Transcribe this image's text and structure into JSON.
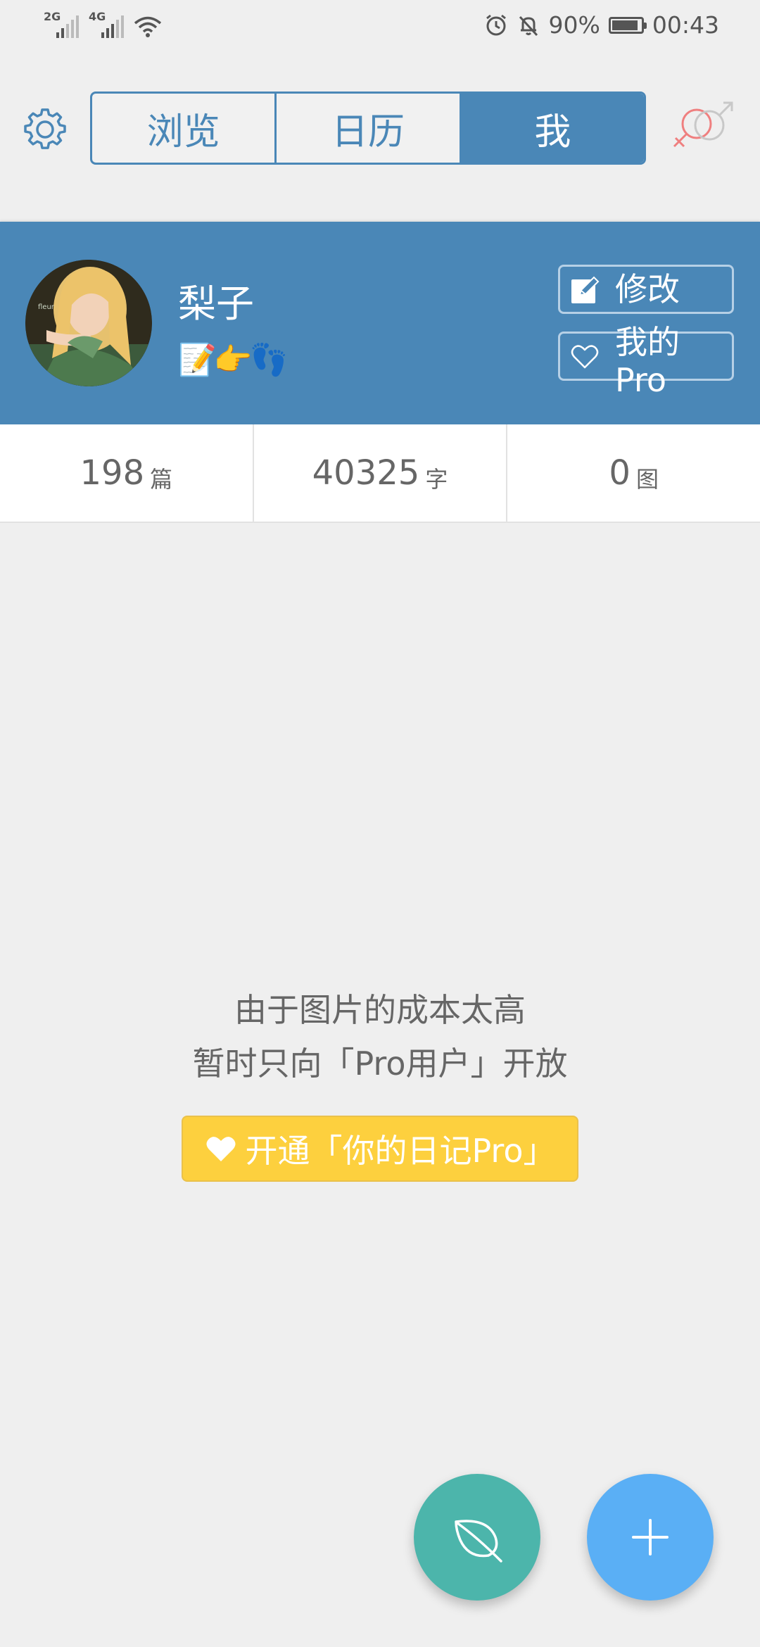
{
  "status_bar": {
    "sim1": "2G",
    "sim2": "4G",
    "battery_percent": "90%",
    "battery_level": 0.9,
    "time": "00:43",
    "icons": [
      "signal-icon",
      "wifi-icon",
      "alarm-icon",
      "mute-bell-icon",
      "battery-icon"
    ]
  },
  "nav": {
    "tabs": [
      {
        "label": "浏览",
        "active": false
      },
      {
        "label": "日历",
        "active": false
      },
      {
        "label": "我",
        "active": true
      }
    ],
    "icons": {
      "left": "gear-icon",
      "right": "gender-icon"
    }
  },
  "profile": {
    "name": "梨子",
    "bio": "📝👉👣",
    "edit_label": "修改",
    "pro_label": "我的Pro",
    "colors": {
      "header": "#4a87b7"
    }
  },
  "stats": [
    {
      "value": "198",
      "unit": "篇"
    },
    {
      "value": "40325",
      "unit": "字"
    },
    {
      "value": "0",
      "unit": "图"
    }
  ],
  "notice": {
    "line1": "由于图片的成本太高",
    "line2": "暂时只向「Pro用户」开放",
    "cta": "开通「你的日记Pro」",
    "cta_color": "#fdd03e"
  },
  "fabs": {
    "leaf_color": "#4cb5ab",
    "add_color": "#5aaff5",
    "icons": [
      "leaf-icon",
      "plus-icon"
    ]
  }
}
